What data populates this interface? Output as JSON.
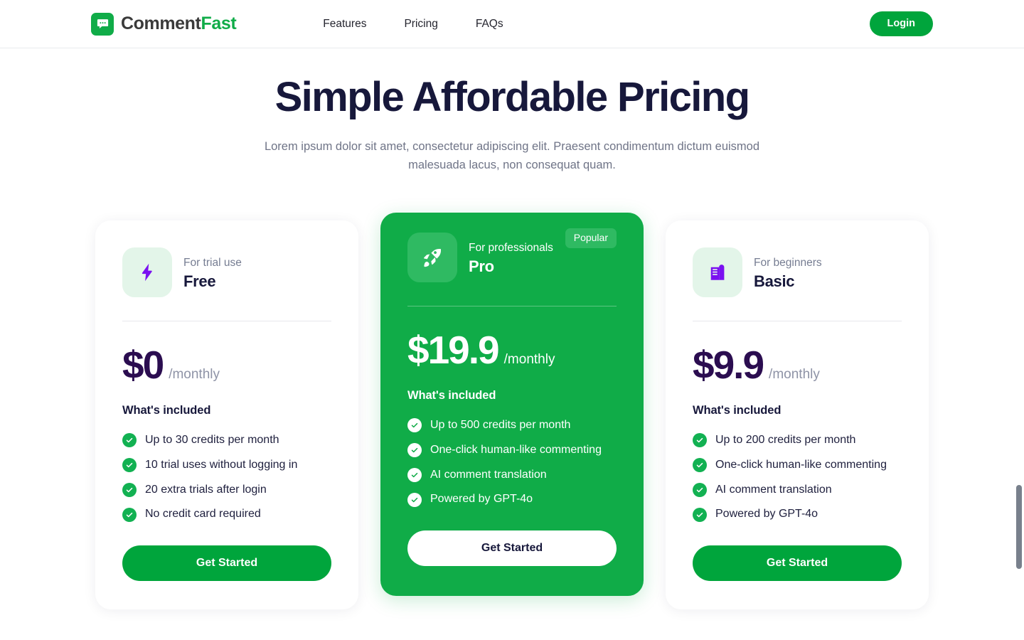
{
  "header": {
    "brand": {
      "name_dark": "Comment",
      "name_accent": "Fast",
      "icon": "speech-bubble-icon"
    },
    "nav": [
      {
        "label": "Features"
      },
      {
        "label": "Pricing"
      },
      {
        "label": "FAQs"
      }
    ],
    "login_label": "Login"
  },
  "hero": {
    "title": "Simple Affordable Pricing",
    "subtitle": "Lorem ipsum dolor sit amet, consectetur adipiscing elit. Praesent condimentum dictum euismod malesuada lacus, non consequat quam."
  },
  "plans": [
    {
      "kicker": "For trial use",
      "name": "Free",
      "icon": "lightning-bolt-icon",
      "price": "$0",
      "period": "/monthly",
      "included_label": "What's included",
      "features": [
        "Up to 30 credits per month",
        "10 trial uses without logging in",
        "20 extra trials after login",
        "No credit card required"
      ],
      "cta_label": "Get Started",
      "badge": ""
    },
    {
      "kicker": "For professionals",
      "name": "Pro",
      "icon": "rocket-icon",
      "price": "$19.9",
      "period": "/monthly",
      "included_label": "What's included",
      "features": [
        "Up to 500 credits per month",
        "One-click human-like commenting",
        "AI comment translation",
        "Powered by GPT-4o"
      ],
      "cta_label": "Get Started",
      "badge": "Popular"
    },
    {
      "kicker": "For beginners",
      "name": "Basic",
      "icon": "office-building-icon",
      "price": "$9.9",
      "period": "/monthly",
      "included_label": "What's included",
      "features": [
        "Up to 200 credits per month",
        "One-click human-like commenting",
        "AI comment translation",
        "Powered by GPT-4o"
      ],
      "cta_label": "Get Started",
      "badge": ""
    }
  ],
  "colors": {
    "brand_green": "#10ac48",
    "button_green": "#00a53c",
    "featured_card": "#10ac48",
    "price_purple": "#2b0d50",
    "heading_navy": "#17183b",
    "muted_text": "#6f7487",
    "icon_purple": "#7a10f0",
    "icon_tile_mint": "#e3f5e9"
  }
}
